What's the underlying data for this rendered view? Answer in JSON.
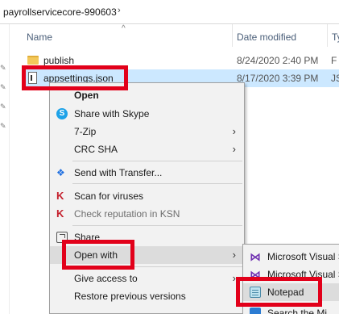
{
  "breadcrumb": {
    "folder": "payrollservicecore-990603",
    "chevron": "›"
  },
  "columns": {
    "name": "Name",
    "date_modified": "Date modified",
    "type": "Ty",
    "sort_glyph": "^"
  },
  "files": [
    {
      "name": "publish",
      "date": "8/24/2020 2:40 PM",
      "type": "F",
      "icon": "folder-icon"
    },
    {
      "name": "appsettings.json",
      "date": "8/17/2020 3:39 PM",
      "type": "JS",
      "icon": "json-file-icon",
      "selected": true
    }
  ],
  "context_menu": {
    "items": [
      {
        "label": "Open",
        "bold": true
      },
      {
        "label": "Share with Skype",
        "icon": "skype-icon"
      },
      {
        "label": "7-Zip",
        "submenu": true
      },
      {
        "label": "CRC SHA",
        "submenu": true
      },
      {
        "label": "Send with Transfer...",
        "icon": "dropbox-icon"
      },
      {
        "label": "Scan for viruses",
        "icon": "kaspersky-icon"
      },
      {
        "label": "Check reputation in KSN",
        "icon": "kaspersky-icon",
        "disabled": true
      },
      {
        "label": "Share",
        "icon": "share-icon"
      },
      {
        "label": "Open with",
        "submenu": true,
        "highlighted": true
      },
      {
        "label": "Give access to",
        "submenu": true
      },
      {
        "label": "Restore previous versions"
      }
    ],
    "arrow_glyph": "›"
  },
  "open_with_menu": {
    "items": [
      {
        "label": "Microsoft Visual S",
        "icon": "visual-studio-icon"
      },
      {
        "label": "Microsoft Visual S",
        "icon": "visual-studio-icon"
      },
      {
        "label": "Notepad",
        "icon": "notepad-icon"
      },
      {
        "label": "Search the Mi",
        "icon": "store-icon"
      }
    ]
  },
  "annotation_color": "#e2001a",
  "selection_color": "#cce8ff"
}
